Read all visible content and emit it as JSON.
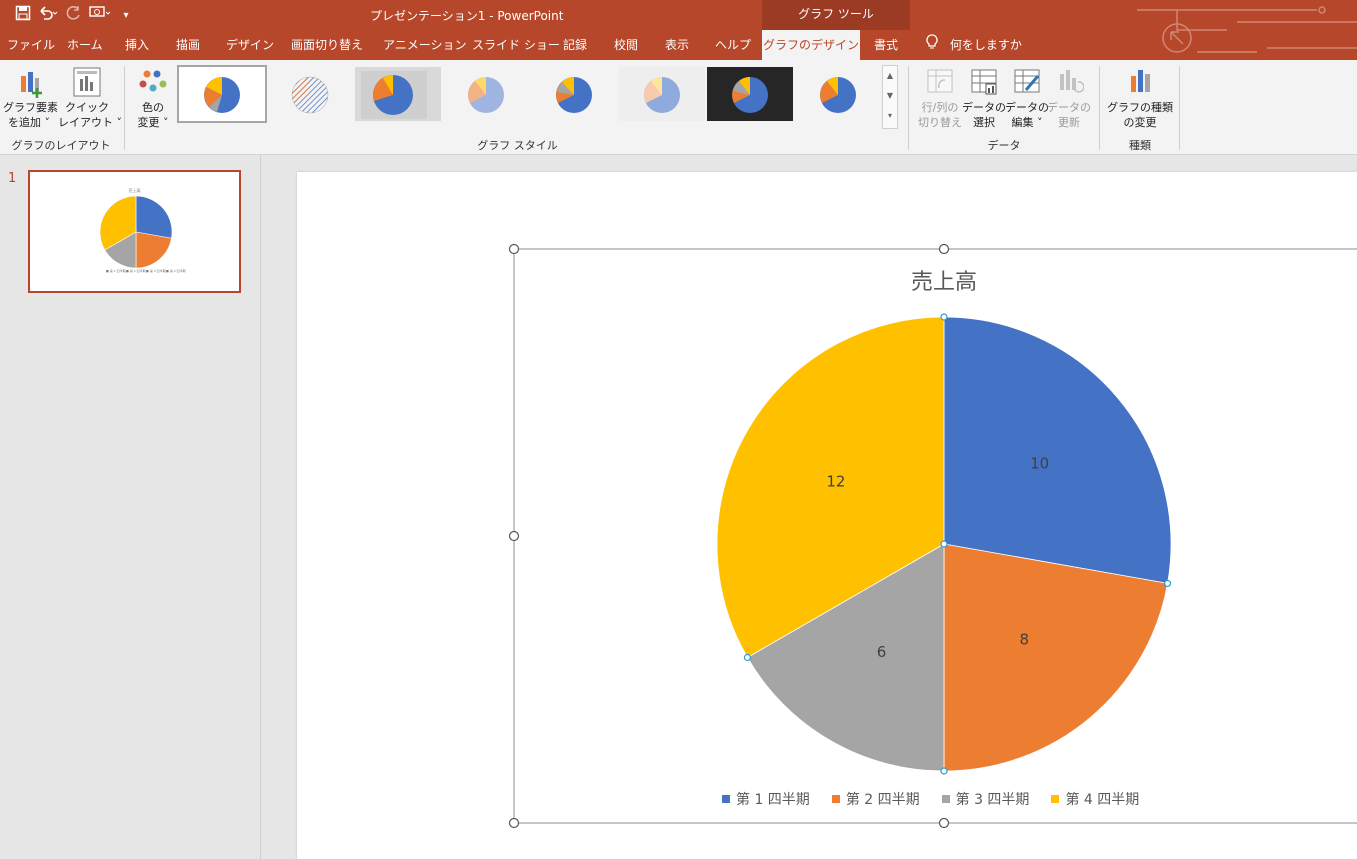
{
  "window": {
    "title": "プレゼンテーション1  -  PowerPoint",
    "context_tool": "グラフ ツール"
  },
  "qat": {
    "save": "💾",
    "undo": "↶",
    "redo": "↻",
    "present": "▣",
    "more": "▾"
  },
  "tabs": [
    {
      "label": "ファイル"
    },
    {
      "label": "ホーム"
    },
    {
      "label": "挿入"
    },
    {
      "label": "描画"
    },
    {
      "label": "デザイン"
    },
    {
      "label": "画面切り替え"
    },
    {
      "label": "アニメーション"
    },
    {
      "label": "スライド ショー"
    },
    {
      "label": "記録"
    },
    {
      "label": "校閲"
    },
    {
      "label": "表示"
    },
    {
      "label": "ヘルプ"
    },
    {
      "label": "グラフのデザイン"
    },
    {
      "label": "書式"
    }
  ],
  "tell_me": "何をしますか",
  "ribbon": {
    "add_element": "グラフ要素\nを追加 ˅",
    "quick_layout": "クイック\nレイアウト ˅",
    "change_color": "色の\n変更 ˅",
    "switch_row_col": "行/列の\n切り替え",
    "select_data": "データの\n選択",
    "edit_data": "データの\n編集 ˅",
    "refresh_data": "データの\n更新",
    "change_type": "グラフの種類\nの変更",
    "groups": {
      "layout": "グラフのレイアウト",
      "styles": "グラフ スタイル",
      "data": "データ",
      "type": "種類"
    }
  },
  "slides_pane": {
    "slide_number": "1"
  },
  "colors": {
    "accent": "#b7472a",
    "q1": "#4472c4",
    "q2": "#ed7d31",
    "q3": "#a5a5a5",
    "q4": "#ffc000"
  },
  "chart_data": {
    "type": "pie",
    "title": "売上高",
    "categories": [
      "第 1 四半期",
      "第 2 四半期",
      "第 3 四半期",
      "第 4 四半期"
    ],
    "values": [
      10,
      8,
      6,
      12
    ],
    "colors": [
      "#4472c4",
      "#ed7d31",
      "#a5a5a5",
      "#ffc000"
    ],
    "legend": "bottom",
    "data_labels": true
  }
}
